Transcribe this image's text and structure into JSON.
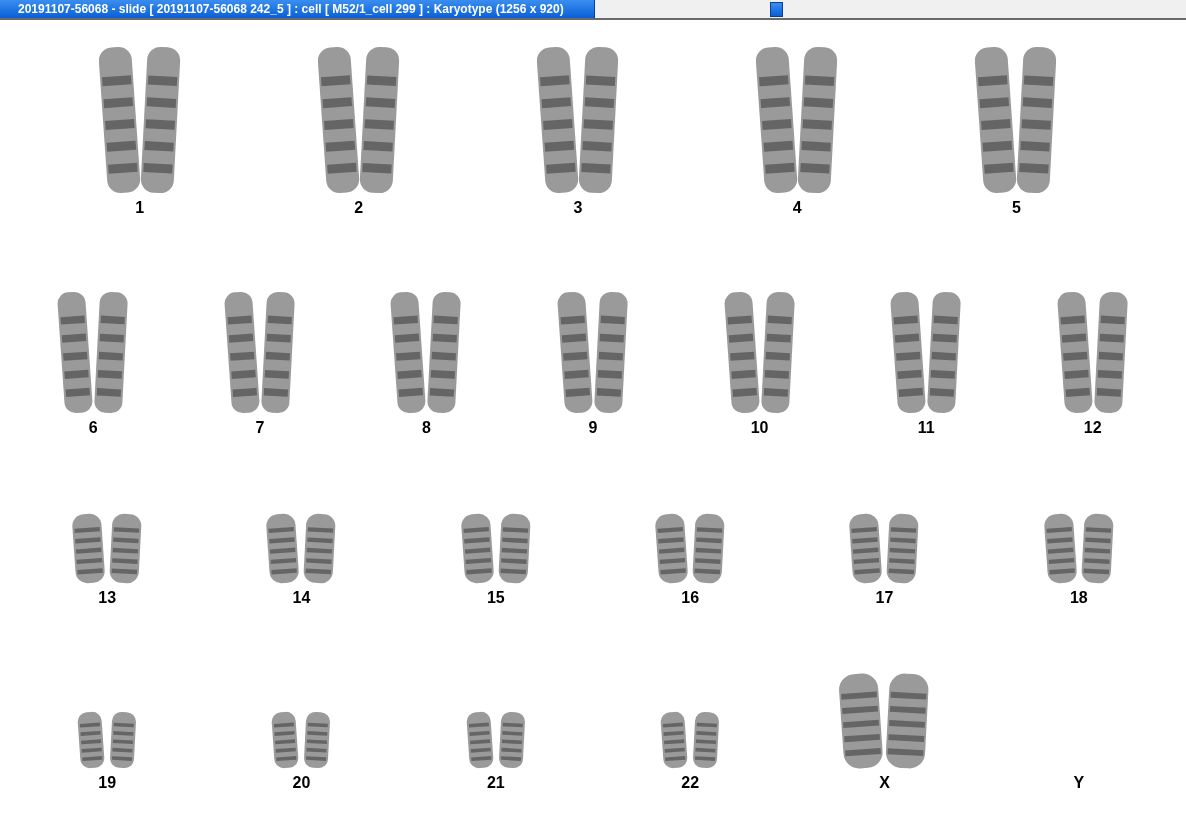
{
  "window": {
    "title": "20191107-56068 - slide [ 20191107-56068 242_5 ] : cell [ M52/1_cell 299 ] : Karyotype  (1256 x 920)"
  },
  "karyotype": {
    "rows": [
      [
        {
          "label": "1",
          "kind": "pair"
        },
        {
          "label": "2",
          "kind": "pair"
        },
        {
          "label": "3",
          "kind": "pair"
        },
        {
          "label": "4",
          "kind": "pair"
        },
        {
          "label": "5",
          "kind": "pair"
        }
      ],
      [
        {
          "label": "6",
          "kind": "pair"
        },
        {
          "label": "7",
          "kind": "pair"
        },
        {
          "label": "8",
          "kind": "pair"
        },
        {
          "label": "9",
          "kind": "pair"
        },
        {
          "label": "10",
          "kind": "pair"
        },
        {
          "label": "11",
          "kind": "pair"
        },
        {
          "label": "12",
          "kind": "pair"
        }
      ],
      [
        {
          "label": "13",
          "kind": "pair"
        },
        {
          "label": "14",
          "kind": "pair"
        },
        {
          "label": "15",
          "kind": "pair"
        },
        {
          "label": "16",
          "kind": "pair"
        },
        {
          "label": "17",
          "kind": "pair"
        },
        {
          "label": "18",
          "kind": "pair"
        }
      ],
      [
        {
          "label": "19",
          "kind": "pair"
        },
        {
          "label": "20",
          "kind": "pair"
        },
        {
          "label": "21",
          "kind": "pair"
        },
        {
          "label": "22",
          "kind": "pair"
        },
        {
          "label": "X",
          "kind": "pair"
        },
        {
          "label": "Y",
          "kind": "empty"
        }
      ]
    ]
  }
}
